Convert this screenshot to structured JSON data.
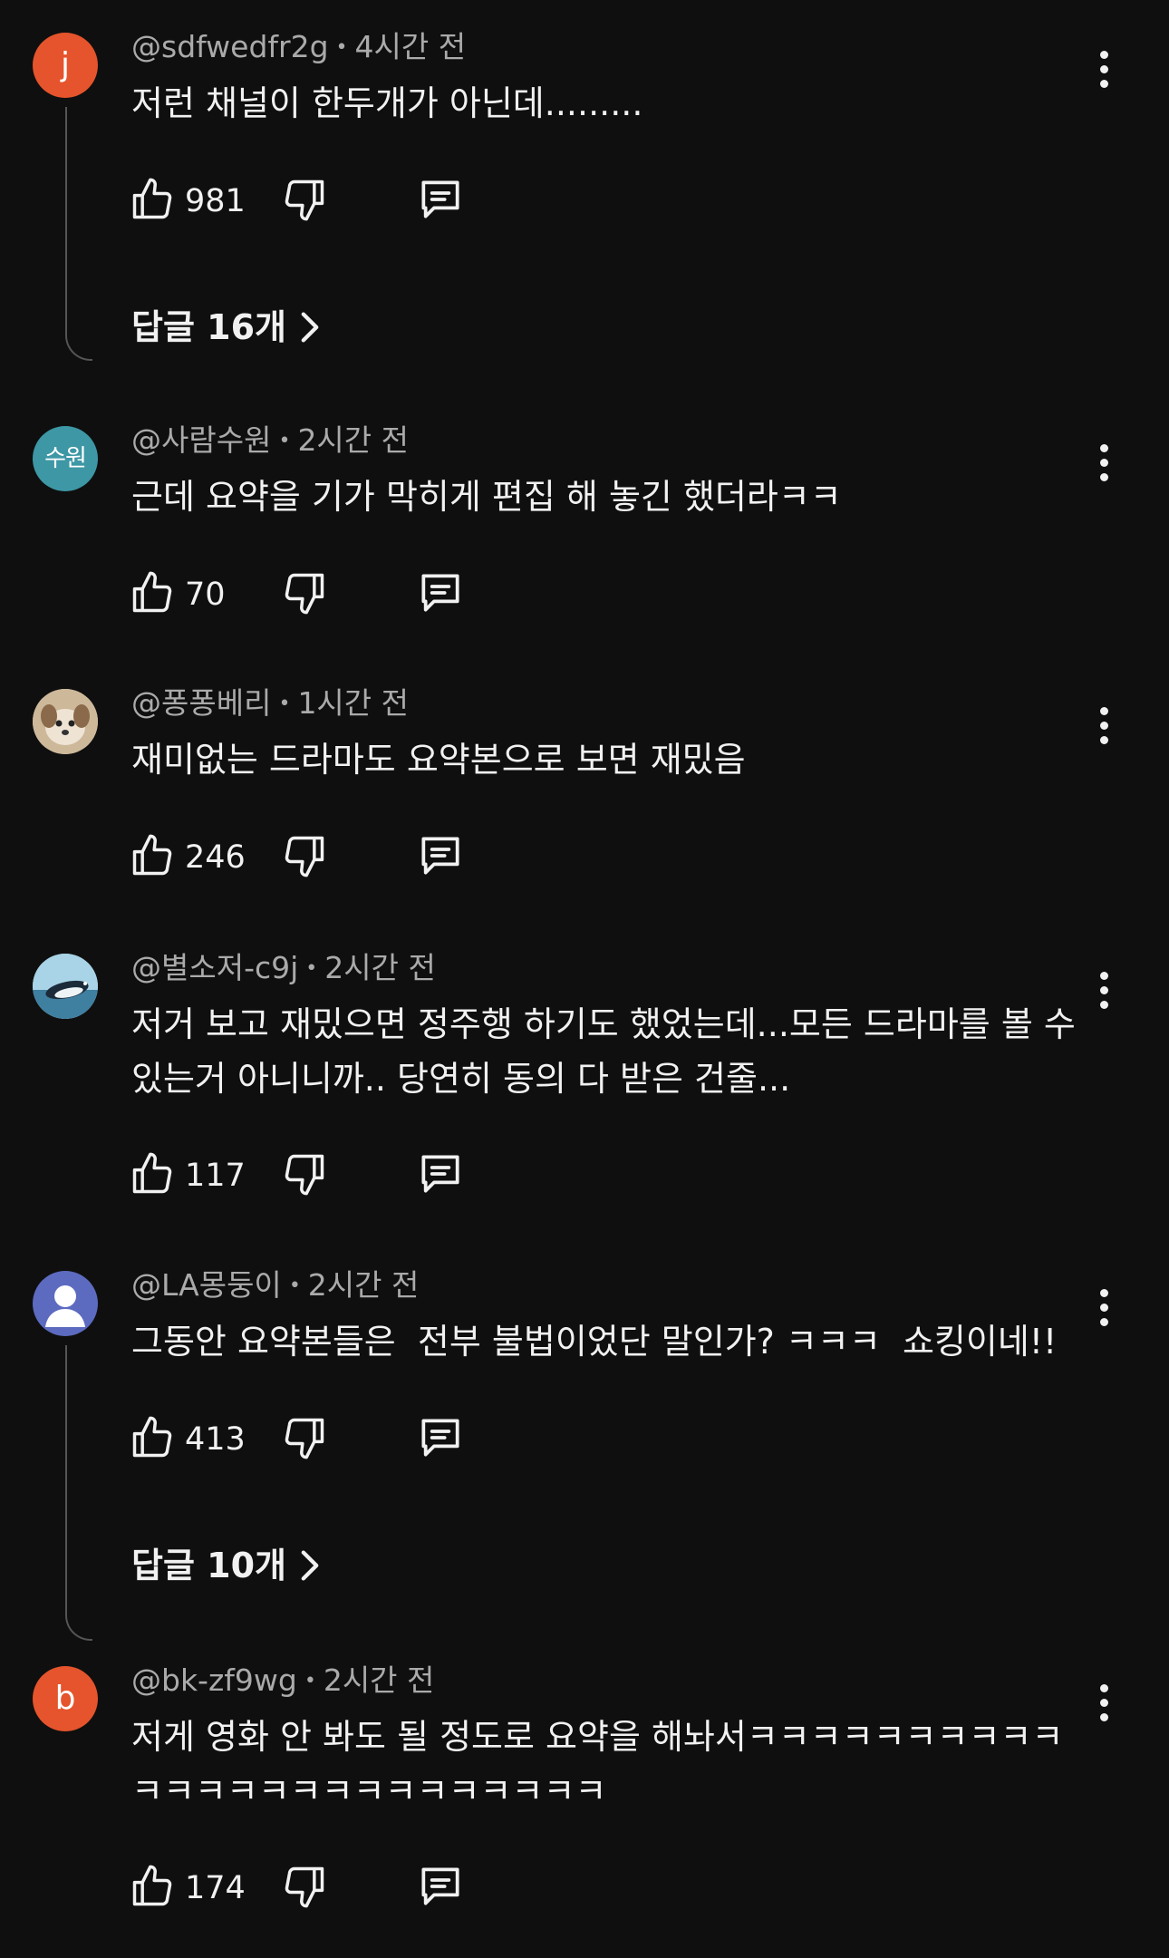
{
  "comments": [
    {
      "avatar_letter": "j",
      "avatar_color": "#e5542c",
      "handle": "@sdfwedfr2g",
      "time": "4시간 전",
      "text": "저런 채널이 한두개가 아닌데.........",
      "likes": "981",
      "replies": "답글 16개"
    },
    {
      "avatar_letter": "수원",
      "avatar_color": "#3d97a5",
      "handle": "@사람수원",
      "time": "2시간 전",
      "text": "근데 요약을 기가 막히게 편집 해 놓긴 했더라ㅋㅋ",
      "likes": "70"
    },
    {
      "avatar_image": "puppy-photo",
      "avatar_color": "#d8c4a8",
      "handle": "@퐁퐁베리",
      "time": "1시간 전",
      "text": "재미없는 드라마도 요약본으로 보면 재밌음",
      "likes": "246"
    },
    {
      "avatar_image": "penguin-photo",
      "avatar_color": "#7fb3c9",
      "handle": "@별소저-c9j",
      "time": "2시간 전",
      "text": "저거 보고 재밌으면 정주행 하기도 했었는데...모든 드라마를 볼 수 있는거 아니니까.. 당연히 동의 다 받은 건줄...",
      "likes": "117"
    },
    {
      "avatar_image": "default-person",
      "avatar_color": "#5c6bc0",
      "handle": "@LA몽둥이",
      "time": "2시간 전",
      "text": "그동안 요약본들은  전부 불법이었단 말인가? ㅋㅋㅋ  쇼킹이네!!",
      "likes": "413",
      "replies": "답글 10개"
    },
    {
      "avatar_letter": "b",
      "avatar_color": "#e5542c",
      "handle": "@bk-zf9wg",
      "time": "2시간 전",
      "text": "저게 영화 안 봐도 될 정도로 요약을 해놔서ㅋㅋㅋㅋㅋㅋㅋㅋㅋㅋ ㅋㅋㅋㅋㅋㅋㅋㅋㅋㅋㅋㅋㅋㅋㅋ",
      "likes": "174"
    }
  ]
}
